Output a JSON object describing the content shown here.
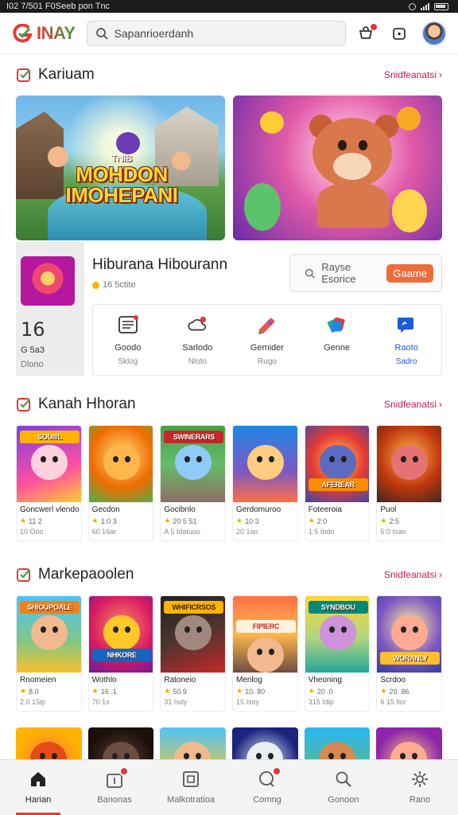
{
  "status_bar": {
    "time_text": "I02 7/501 F0Seeb pon  Tnc"
  },
  "header": {
    "logo_text": "INAY",
    "search": {
      "value": "Sapanrioerdanh",
      "placeholder": "Sapanrioerdanh"
    },
    "icons": [
      "cart-icon",
      "notification-icon",
      "avatar"
    ]
  },
  "hero_section": {
    "title": "Kariuam",
    "link": "Snidfeanatsi",
    "banners": [
      {
        "small_text": "TNIB",
        "title_line1": "MOHDON",
        "title_line2": "IMOHEPANI"
      },
      {
        "title": ""
      }
    ]
  },
  "featured": {
    "name": "Hiburana Hibourann",
    "sub": "16 5ctite",
    "stat_num": "16",
    "stat_a": "G 5a3",
    "stat_b": "Dlono",
    "search_text": "Rayse Esorice",
    "search_button": "Gaame",
    "categories": [
      {
        "label": "Goodo",
        "sub": "Sklog",
        "icon": "list-icon"
      },
      {
        "label": "Sarlodo",
        "sub": "Nloto",
        "icon": "cloud-icon"
      },
      {
        "label": "Gemider",
        "sub": "Rugo",
        "icon": "pencil-icon"
      },
      {
        "label": "Genne",
        "sub": "",
        "icon": "cards-icon"
      },
      {
        "label": "Raoto",
        "sub": "Sadro",
        "icon": "chat-icon"
      }
    ]
  },
  "section2": {
    "title": "Kanah Hhoran",
    "link": "Snidfeanatsi",
    "items": [
      {
        "banner": "SOUIIIL",
        "name": "Goncwerl vlendo",
        "meta": "11 2",
        "meta2": "10  Ooo"
      },
      {
        "banner": "",
        "name": "Gecdon",
        "meta": "1:0 3",
        "meta2": "60 16ar"
      },
      {
        "banner": "SWINERARS",
        "name": "Gocibnlo",
        "meta": "20 5 51",
        "meta2": "A 5 Idatuuo"
      },
      {
        "banner": "",
        "name": "Gerdomuroo",
        "meta": "10 3",
        "meta2": "20 1ao"
      },
      {
        "banner": "AFEREAR",
        "name": "Foteeroia",
        "meta": "2:0",
        "meta2": "1:5 Ibdo"
      },
      {
        "banner": "",
        "name": "Puol",
        "meta": "2:5",
        "meta2": "5:0 Ioav"
      }
    ]
  },
  "section3": {
    "title": "Markepaoolen",
    "link": "Snidfeanatsi",
    "items": [
      {
        "banner": "SHIOUPOALE",
        "name": "Rnomeien",
        "meta": "8.0",
        "meta2": "2.0 15ip"
      },
      {
        "banner": "NHKORE",
        "name": "Wothlo",
        "meta": "16 .1",
        "meta2": "70 1s"
      },
      {
        "banner": "WHIFICRSOS",
        "name": "Ratoneio",
        "meta": "50.9",
        "meta2": "31 Isdy"
      },
      {
        "banner": "FIPIERC",
        "name": "Menlog",
        "meta": "10. 80",
        "meta2": "15 Isoy"
      },
      {
        "banner": "SYNDBOU",
        "name": "Vheoning",
        "meta": "20 .0",
        "meta2": "315 Idip"
      },
      {
        "banner": "WORANLY",
        "name": "Scrdoo",
        "meta": "29. 86",
        "meta2": "6 15 Ilor"
      }
    ]
  },
  "bottom_nav": [
    {
      "label": "Harian",
      "icon": "home-icon",
      "active": true
    },
    {
      "label": "Banonas",
      "icon": "gift-icon",
      "badge": true
    },
    {
      "label": "Malkotratioa",
      "icon": "box-icon"
    },
    {
      "label": "Comng",
      "icon": "chat-icon",
      "badge": true
    },
    {
      "label": "Gonoon",
      "icon": "search-icon"
    },
    {
      "label": "Rano",
      "icon": "gear-icon"
    }
  ]
}
